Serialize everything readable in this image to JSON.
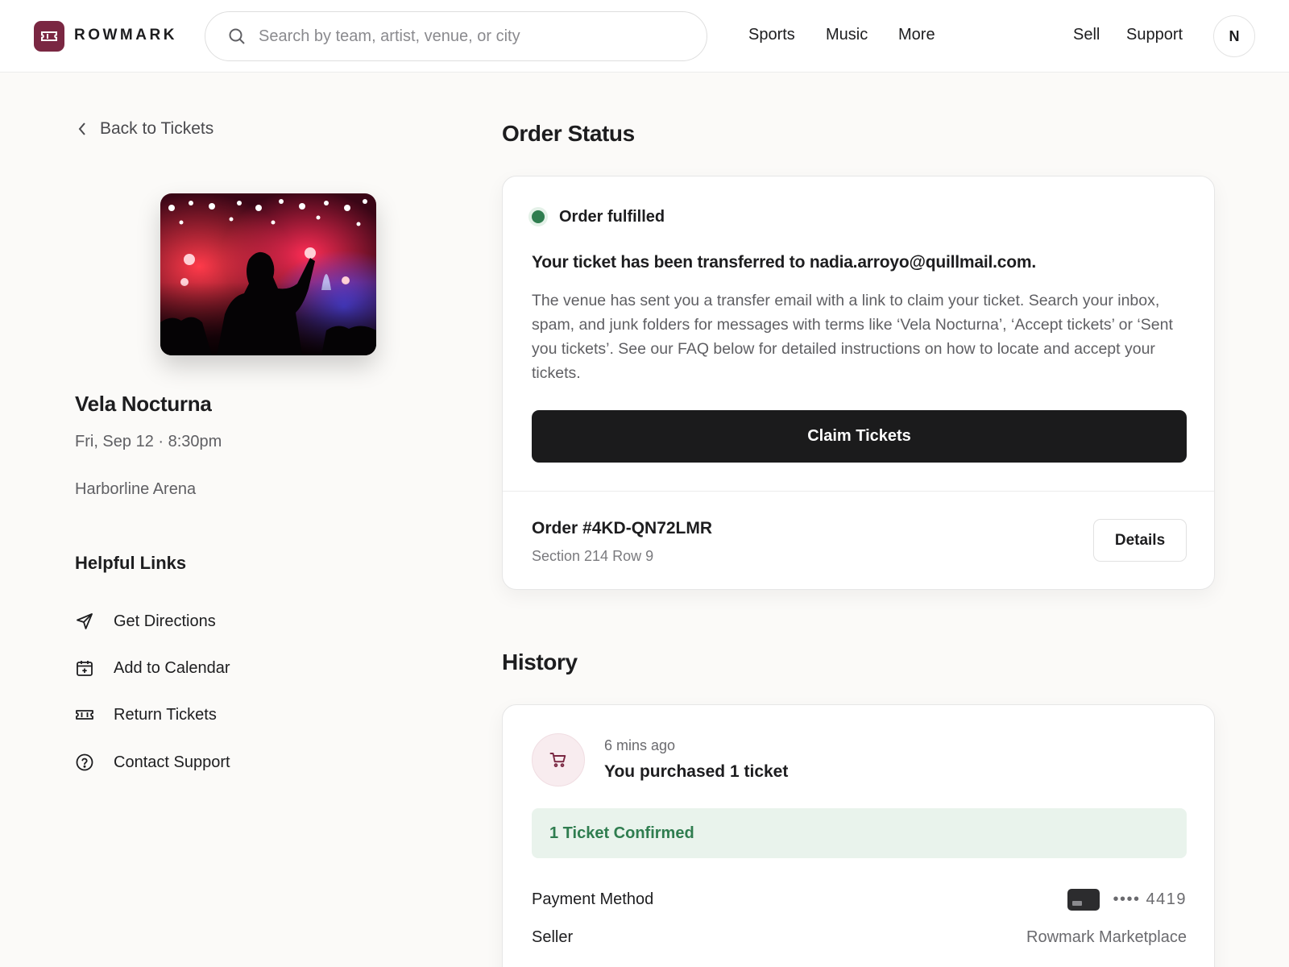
{
  "header": {
    "brand": "ROWMARK",
    "search_placeholder": "Search by team, artist, venue, or city",
    "nav": [
      "Sports",
      "Music",
      "More"
    ],
    "nav_right": [
      "Sell",
      "Support"
    ],
    "avatar_initial": "N"
  },
  "sidebar": {
    "back_label": "Back to Tickets",
    "event_name": "Vela Nocturna",
    "event_date": "Fri, Sep 12 · 8:30pm",
    "venue": "Harborline Arena",
    "helpful_title": "Helpful Links",
    "links": [
      {
        "label": "Get Directions",
        "icon": "send-icon"
      },
      {
        "label": "Add to Calendar",
        "icon": "calendar-add-icon"
      },
      {
        "label": "Return Tickets",
        "icon": "ticket-icon"
      },
      {
        "label": "Contact Support",
        "icon": "help-circle-icon"
      }
    ]
  },
  "order_status": {
    "section_title": "Order Status",
    "status_label": "Order fulfilled",
    "status_color": "#2f7d4f",
    "headline": "Your ticket has been transferred to nadia.arroyo@quillmail.com.",
    "body": "The venue has sent you a transfer email with a link to claim your ticket. Search your inbox, spam, and junk folders for messages with terms like ‘Vela Nocturna’, ‘Accept tickets’ or ‘Sent you tickets’. See our FAQ below for detailed instructions on how to locate and accept your tickets.",
    "claim_label": "Claim Tickets",
    "order_number": "Order #4KD-QN72LMR",
    "seat": "Section 214 Row 9",
    "details_label": "Details"
  },
  "history": {
    "section_title": "History",
    "time": "6 mins ago",
    "headline": "You purchased 1 ticket",
    "confirmed": "1 Ticket Confirmed",
    "payment_label": "Payment Method",
    "payment_value": "•••• 4419",
    "seller_label": "Seller",
    "seller_value": "Rowmark Marketplace"
  },
  "colors": {
    "brand": "#7a2742",
    "primary_button": "#1b1b1c",
    "success": "#2f7d4f"
  }
}
